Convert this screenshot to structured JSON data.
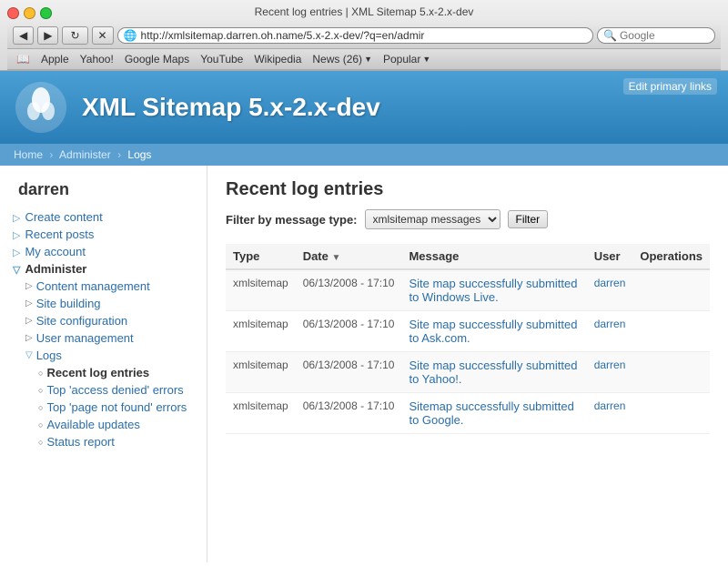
{
  "window": {
    "title": "Recent log entries | XML Sitemap 5.x-2.x-dev",
    "url": "http://xmlsitemap.darren.oh.name/5.x-2.x-dev/?q=en/admir",
    "search_placeholder": "Google"
  },
  "bookmarks": {
    "items": [
      "Apple",
      "Yahoo!",
      "Google Maps",
      "YouTube",
      "Wikipedia"
    ],
    "news_label": "News (26)",
    "popular_label": "Popular"
  },
  "header": {
    "site_title": "XML Sitemap 5.x-2.x-dev",
    "edit_links_label": "Edit primary links"
  },
  "breadcrumb": {
    "home": "Home",
    "administer": "Administer",
    "logs": "Logs"
  },
  "sidebar": {
    "username": "darren",
    "links": [
      {
        "label": "Create content",
        "indent": 1
      },
      {
        "label": "Recent posts",
        "indent": 1
      },
      {
        "label": "My account",
        "indent": 1
      },
      {
        "label": "Administer",
        "indent": 0,
        "section": true
      },
      {
        "label": "Content management",
        "indent": 2
      },
      {
        "label": "Site building",
        "indent": 2
      },
      {
        "label": "Site configuration",
        "indent": 2
      },
      {
        "label": "User management",
        "indent": 2
      },
      {
        "label": "Logs",
        "indent": 2,
        "subsection": true
      },
      {
        "label": "Recent log entries",
        "indent": 3,
        "current": true
      },
      {
        "label": "Top 'access denied' errors",
        "indent": 3
      },
      {
        "label": "Top 'page not found' errors",
        "indent": 3
      },
      {
        "label": "Available updates",
        "indent": 3
      },
      {
        "label": "Status report",
        "indent": 3
      }
    ]
  },
  "main": {
    "page_title": "Recent log entries",
    "filter_label": "Filter by message type:",
    "filter_value": "xmlsitemap messages",
    "filter_button": "Filter",
    "table": {
      "columns": [
        "Type",
        "Date",
        "Message",
        "User",
        "Operations"
      ],
      "rows": [
        {
          "type": "xmlsitemap",
          "date": "06/13/2008 - 17:10",
          "message": "Site map successfully submitted to Windows Live.",
          "user": "darren",
          "ops": "",
          "alt": true
        },
        {
          "type": "xmlsitemap",
          "date": "06/13/2008 - 17:10",
          "message": "Site map successfully submitted to Ask.com.",
          "user": "darren",
          "ops": "",
          "alt": false
        },
        {
          "type": "xmlsitemap",
          "date": "06/13/2008 - 17:10",
          "message": "Site map successfully submitted to Yahoo!.",
          "user": "darren",
          "ops": "",
          "alt": true
        },
        {
          "type": "xmlsitemap",
          "date": "06/13/2008 - 17:10",
          "message": "Sitemap successfully submitted to Google.",
          "user": "darren",
          "ops": "",
          "alt": false
        }
      ]
    }
  }
}
